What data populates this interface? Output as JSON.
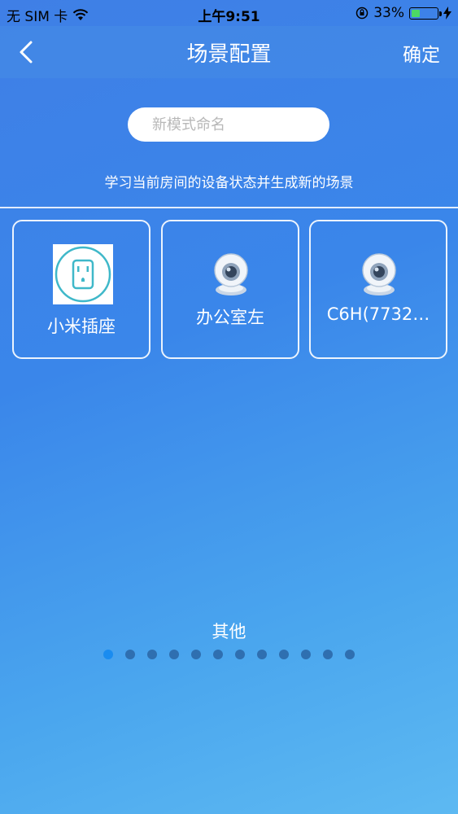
{
  "status_bar": {
    "carrier": "无 SIM 卡",
    "time": "上午9:51",
    "battery": "33%",
    "battery_level": 0.33
  },
  "nav": {
    "title": "场景配置",
    "confirm_label": "确定"
  },
  "name_input": {
    "placeholder": "新模式命名",
    "value": ""
  },
  "hint": "学习当前房间的设备状态并生成新的场景",
  "devices": [
    {
      "label": "小米插座",
      "icon": "smart-plug-icon"
    },
    {
      "label": "办公室左",
      "icon": "camera-icon"
    },
    {
      "label": "C6H(7732…",
      "icon": "camera-icon"
    }
  ],
  "section_title": "其他",
  "pagination": {
    "count": 12,
    "active": 0
  },
  "colors": {
    "accent": "#1a8cf0",
    "plug_icon": "#3fb8c9"
  }
}
